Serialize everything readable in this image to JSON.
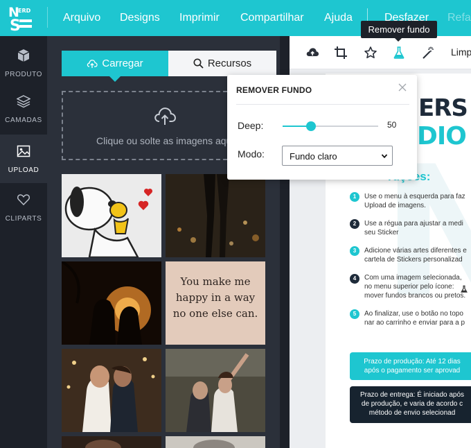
{
  "app": {
    "logo_text": "NERD STUDIO"
  },
  "menu": {
    "items": [
      "Arquivo",
      "Designs",
      "Imprimir",
      "Compartilhar",
      "Ajuda"
    ],
    "undo": "Desfazer",
    "redo": "Refa"
  },
  "rail": {
    "items": [
      {
        "label": "PRODUTO",
        "icon": "cube-icon"
      },
      {
        "label": "CAMADAS",
        "icon": "layers-icon"
      },
      {
        "label": "UPLOAD",
        "icon": "image-icon"
      },
      {
        "label": "CLIPARTS",
        "icon": "heart-icon"
      }
    ],
    "active": "UPLOAD"
  },
  "upload_panel": {
    "tab_upload": "Carregar",
    "tab_resources": "Recursos",
    "dropzone_text": "Clique ou solte as imagens aqui",
    "thumbnails": [
      {
        "name": "snoopy-woodstock",
        "text": ""
      },
      {
        "name": "couple-city-lights",
        "text": ""
      },
      {
        "name": "couple-silhouette-palms",
        "text": ""
      },
      {
        "name": "quote-card",
        "text": "You make me happy in a way no one else can."
      },
      {
        "name": "couple-kiss-lights",
        "text": ""
      },
      {
        "name": "couple-dance",
        "text": ""
      },
      {
        "name": "photo-row-7",
        "text": ""
      },
      {
        "name": "photo-row-8",
        "text": ""
      }
    ]
  },
  "toolbar": {
    "tools": [
      "upload-cloud-icon",
      "crop-icon",
      "star-icon",
      "flask-icon",
      "magic-wand-icon"
    ],
    "clear_label": "Limp",
    "tooltip": "Remover fundo"
  },
  "remove_bg_popover": {
    "title": "REMOVER FUNDO",
    "deep_label": "Deep:",
    "deep_value": "50",
    "deep_fraction": 0.3,
    "mode_label": "Modo:",
    "mode_value": "Fundo claro"
  },
  "sheet": {
    "brand_top": "ERS",
    "brand_bottom": "DIO",
    "instructions_title": "ruções:",
    "steps": [
      {
        "num": "1",
        "text": "Use o menu à esquerda para faz\nUpload de imagens."
      },
      {
        "num": "2",
        "text": "Use a régua para ajustar a medi\nseu Sticker"
      },
      {
        "num": "3",
        "text": "Adicione várias artes diferentes e\ncartela de Stickers personalizad"
      },
      {
        "num": "4",
        "text": "Com uma imagem selecionada, \nno menu superior pelo ícone:\nmover fundos brancos ou pretos."
      },
      {
        "num": "5",
        "text": "Ao finalizar, use o botão no topo\nnar ao carrinho e enviar para a p"
      }
    ],
    "production_box": "Prazo de produção: Até 12 dias\napós o pagamento ser aprovad",
    "delivery_box": "Prazo de entrega: É iniciado após\nde produção, e varia de acordo c\nmétodo de envio selecionad"
  },
  "colors": {
    "accent": "#1ec6d0",
    "dark": "#1d2129",
    "panel": "#2b303a"
  }
}
